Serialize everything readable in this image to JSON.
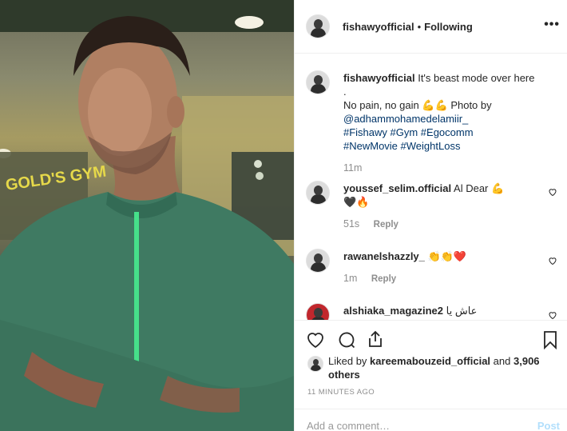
{
  "colors": {
    "accent_link": "#003569",
    "muted": "#8e8e8e",
    "post_disabled": "#b2dffc",
    "heart": "#e0245e"
  },
  "photo": {
    "icon": "person-portrait-photo",
    "sign_text": "GOLD'S GYM"
  },
  "header": {
    "username": "fishawyofficial",
    "separator": "•",
    "follow_state": "Following",
    "more_icon": "ellipsis-icon"
  },
  "caption": {
    "username": "fishawyofficial",
    "text_1": "It's beast mode over here .",
    "text_2": "No pain, no gain",
    "emoji_1": "💪💪",
    "text_3": "Photo by",
    "mention": "@adhammohamedelamiir_",
    "hashtags_1": "#Fishawy #Gym #Egocomm",
    "hashtags_2": "#NewMovie #WeightLoss",
    "time": "11m"
  },
  "comments": [
    {
      "username": "youssef_selim.official",
      "text": "Al Dear",
      "emoji_1": "💪",
      "emoji_2": "🖤🔥",
      "time": "51s",
      "reply": "Reply"
    },
    {
      "username": "rawanelshazzly_",
      "text": "",
      "emoji_1": "👏👏❤️",
      "time": "1m",
      "reply": "Reply"
    },
    {
      "username": "alshiaka_magazine2",
      "text": "عاش يا"
    }
  ],
  "likes": {
    "prefix": "Liked by",
    "user": "kareemabouzeid_official",
    "middle": "and",
    "count": "3,906 others"
  },
  "timestamp": "11 MINUTES AGO",
  "add_comment": {
    "placeholder": "Add a comment…",
    "post_label": "Post"
  }
}
